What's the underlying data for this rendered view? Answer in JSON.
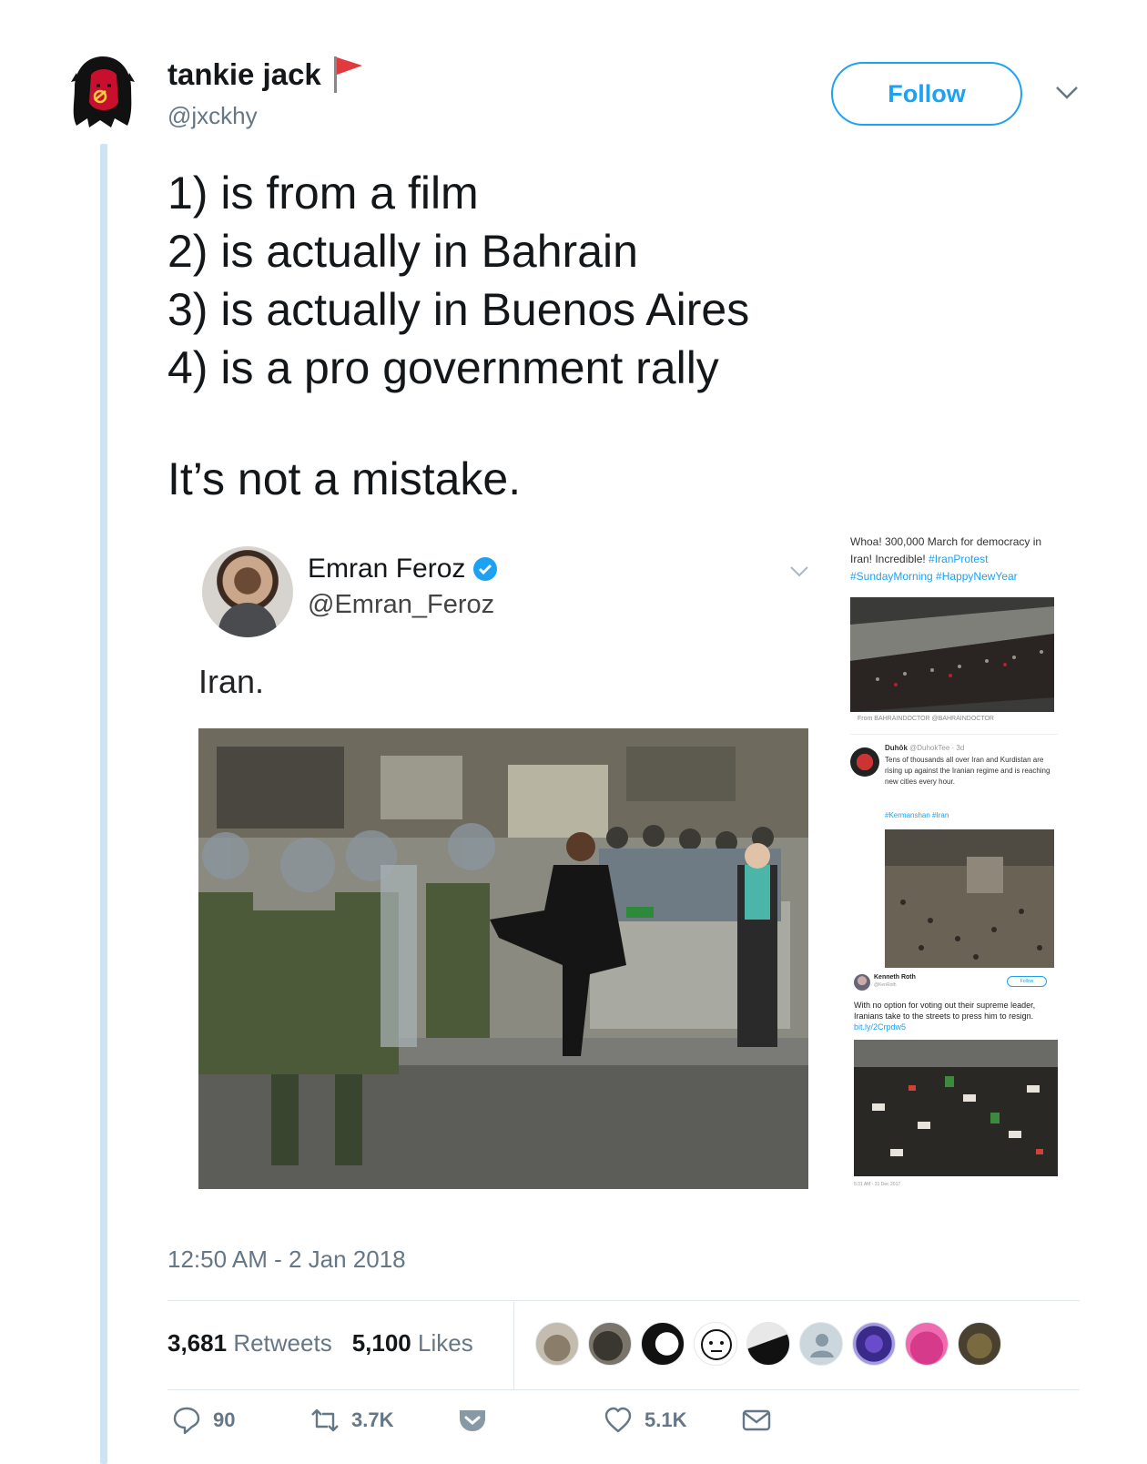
{
  "tweet": {
    "author_name": "tankie jack",
    "author_handle": "@jxckhy",
    "follow_label": "Follow",
    "text_lines": [
      "1) is from a film",
      "2) is actually in Bahrain",
      "3) is actually in Buenos Aires",
      "4) is a pro government rally"
    ],
    "text_closing": "It’s not a mistake.",
    "timestamp": "12:50 AM - 2 Jan 2018",
    "retweets_count": "3,681",
    "retweets_label": "Retweets",
    "likes_count": "5,100",
    "likes_label": "Likes"
  },
  "embedded": {
    "author_name": "Emran Feroz",
    "author_handle": "@Emran_Feroz",
    "text": "Iran."
  },
  "side_tweets": {
    "first_text": "Whoa! 300,000 March for democracy in Iran! Incredible!",
    "first_tags": "#IranProtest #SundayMorning #HappyNewYear",
    "first_from": "From BAHRAINDOCTOR @BAHRAINDOCTOR",
    "second_name": "Duhôk",
    "second_handle": "@DuhokTee · 3d",
    "second_text": "Tens of thousands all over Iran and Kurdistan are rising up against the Iranian regime and is reaching new cities every hour.",
    "second_tags": "#Kermanshan #Iran",
    "third_name": "Kenneth Roth",
    "third_handle": "@KenRoth",
    "third_follow": "Follow",
    "third_text": "With no option for voting out their supreme leader, Iranians take to the streets to press him to resign.",
    "third_link": "bit.ly/2Crpdw5",
    "third_time": "5:31 AM - 31 Dec 2017"
  },
  "actions": {
    "reply_count": "90",
    "retweet_count": "3.7K",
    "like_count": "5.1K"
  },
  "colors": {
    "accent": "#1da1f2",
    "thread_line": "#cbe5f5",
    "secondary_text": "#657786"
  },
  "icons": {
    "flag": "red-flag-icon",
    "caret": "chevron-down-icon",
    "reply": "reply-icon",
    "retweet": "retweet-icon",
    "pocket": "pocket-icon",
    "like": "heart-icon",
    "dm": "envelope-icon"
  }
}
